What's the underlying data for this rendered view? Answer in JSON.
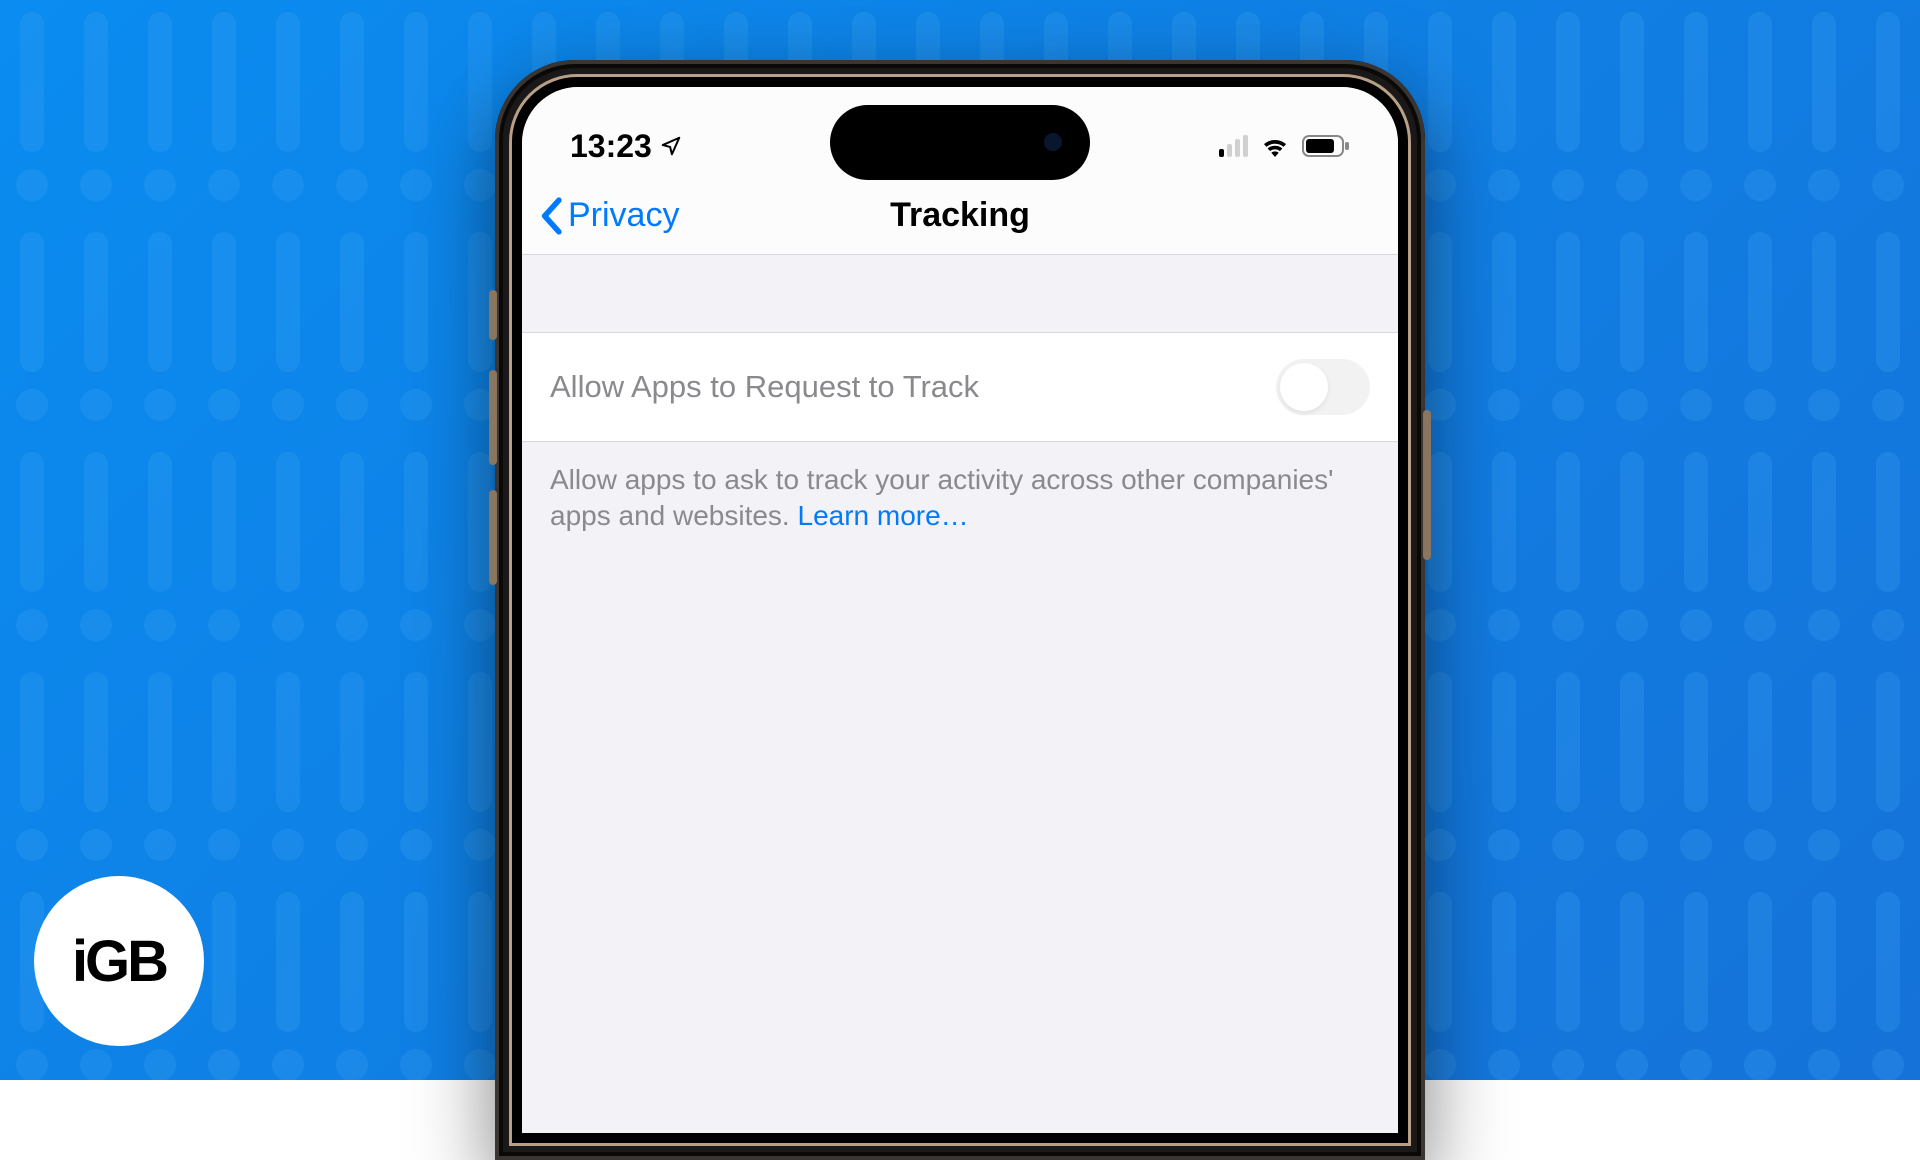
{
  "status": {
    "time": "13:23",
    "signal_strength": 1
  },
  "nav": {
    "back_label": "Privacy",
    "title": "Tracking"
  },
  "setting": {
    "label": "Allow Apps to Request to Track",
    "enabled": false,
    "description": "Allow apps to ask to track your activity across other companies' apps and websites. ",
    "learn_more": "Learn more…"
  },
  "watermark": "iGB"
}
